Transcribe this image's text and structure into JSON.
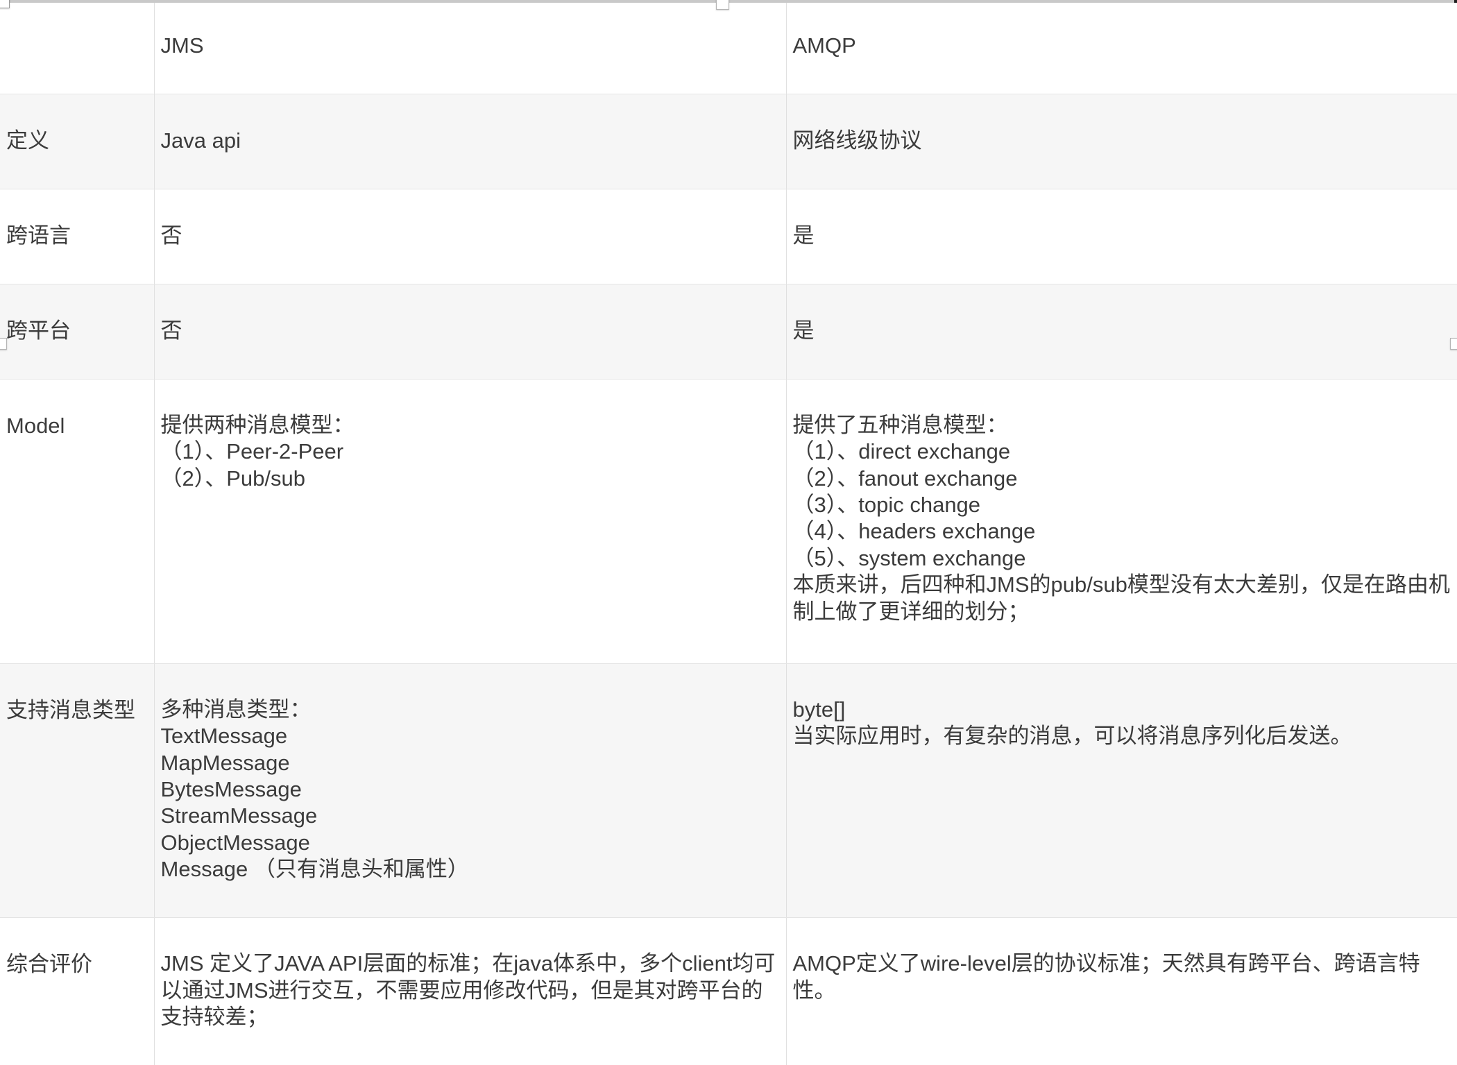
{
  "table": {
    "columns": [
      "",
      "JMS",
      "AMQP"
    ],
    "rows": [
      {
        "label": "定义",
        "jms": "Java api",
        "amqp": "网络线级协议"
      },
      {
        "label": "跨语言",
        "jms": "否",
        "amqp": "是"
      },
      {
        "label": "跨平台",
        "jms": "否",
        "amqp": "是"
      },
      {
        "label": "Model",
        "jms": "提供两种消息模型：\n（1）、Peer-2-Peer\n（2）、Pub/sub",
        "amqp": "提供了五种消息模型：\n（1）、direct exchange\n（2）、fanout exchange\n（3）、topic change\n（4）、headers exchange\n（5）、system exchange\n本质来讲，后四种和JMS的pub/sub模型没有太大差别，仅是在路由机制上做了更详细的划分；"
      },
      {
        "label": "支持消息类型",
        "jms": "多种消息类型：\nTextMessage\nMapMessage\nBytesMessage\nStreamMessage\nObjectMessage\nMessage （只有消息头和属性）",
        "amqp": "byte[]\n当实际应用时，有复杂的消息，可以将消息序列化后发送。"
      },
      {
        "label": "综合评价",
        "jms": "JMS 定义了JAVA API层面的标准；在java体系中，多个client均可以通过JMS进行交互，不需要应用修改代码，但是其对跨平台的支持较差；",
        "amqp": "AMQP定义了wire-level层的协议标准；天然具有跨平台、跨语言特性。"
      }
    ]
  },
  "colors": {
    "text": "#3b3b3b",
    "row_shade": "#f6f6f6",
    "row_plain": "#ffffff",
    "border": "#e0e0e0",
    "top_rule": "#c9c9c9"
  }
}
